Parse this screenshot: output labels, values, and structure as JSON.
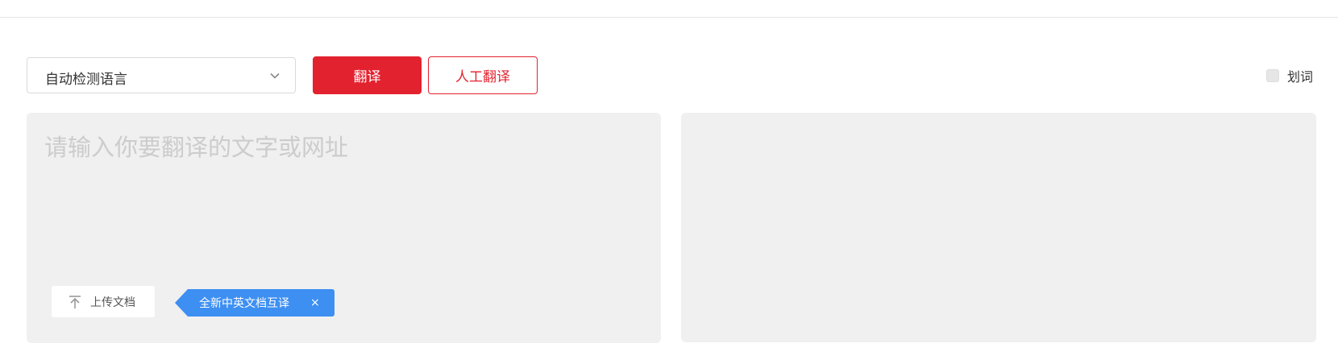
{
  "toolbar": {
    "language_select": {
      "value": "自动检测语言",
      "icon": "chevron-down-icon"
    },
    "translate_label": "翻译",
    "human_translate_label": "人工翻译",
    "word_select_label": "划词",
    "word_select_checked": false
  },
  "source": {
    "placeholder": "请输入你要翻译的文字或网址",
    "value": "",
    "upload_label": "上传文档",
    "upload_icon": "upload-icon",
    "promo_text": "全新中英文档互译",
    "promo_close": "×"
  },
  "colors": {
    "accent": "#e3222f",
    "promo": "#3d8ff2",
    "panel": "#f0f0f0"
  }
}
